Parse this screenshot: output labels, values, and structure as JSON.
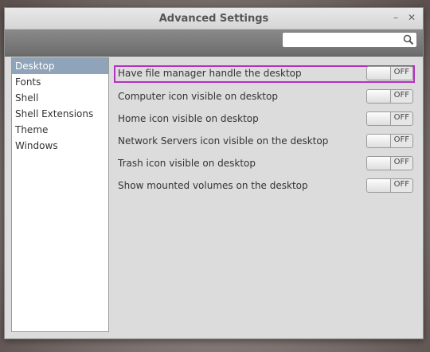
{
  "window": {
    "title": "Advanced Settings"
  },
  "search": {
    "value": "",
    "placeholder": ""
  },
  "sidebar": {
    "items": [
      {
        "label": "Desktop"
      },
      {
        "label": "Fonts"
      },
      {
        "label": "Shell"
      },
      {
        "label": "Shell Extensions"
      },
      {
        "label": "Theme"
      },
      {
        "label": "Windows"
      }
    ],
    "selected": "Desktop"
  },
  "settings": [
    {
      "label": "Have file manager handle the desktop",
      "state": "OFF",
      "highlighted": true
    },
    {
      "label": "Computer icon visible on desktop",
      "state": "OFF"
    },
    {
      "label": "Home icon visible on desktop",
      "state": "OFF"
    },
    {
      "label": "Network Servers icon visible on the desktop",
      "state": "OFF"
    },
    {
      "label": "Trash icon visible on desktop",
      "state": "OFF"
    },
    {
      "label": "Show mounted volumes on the desktop",
      "state": "OFF"
    }
  ],
  "colors": {
    "highlight_border": "#b531c2",
    "selection": "#8fa4b8"
  }
}
